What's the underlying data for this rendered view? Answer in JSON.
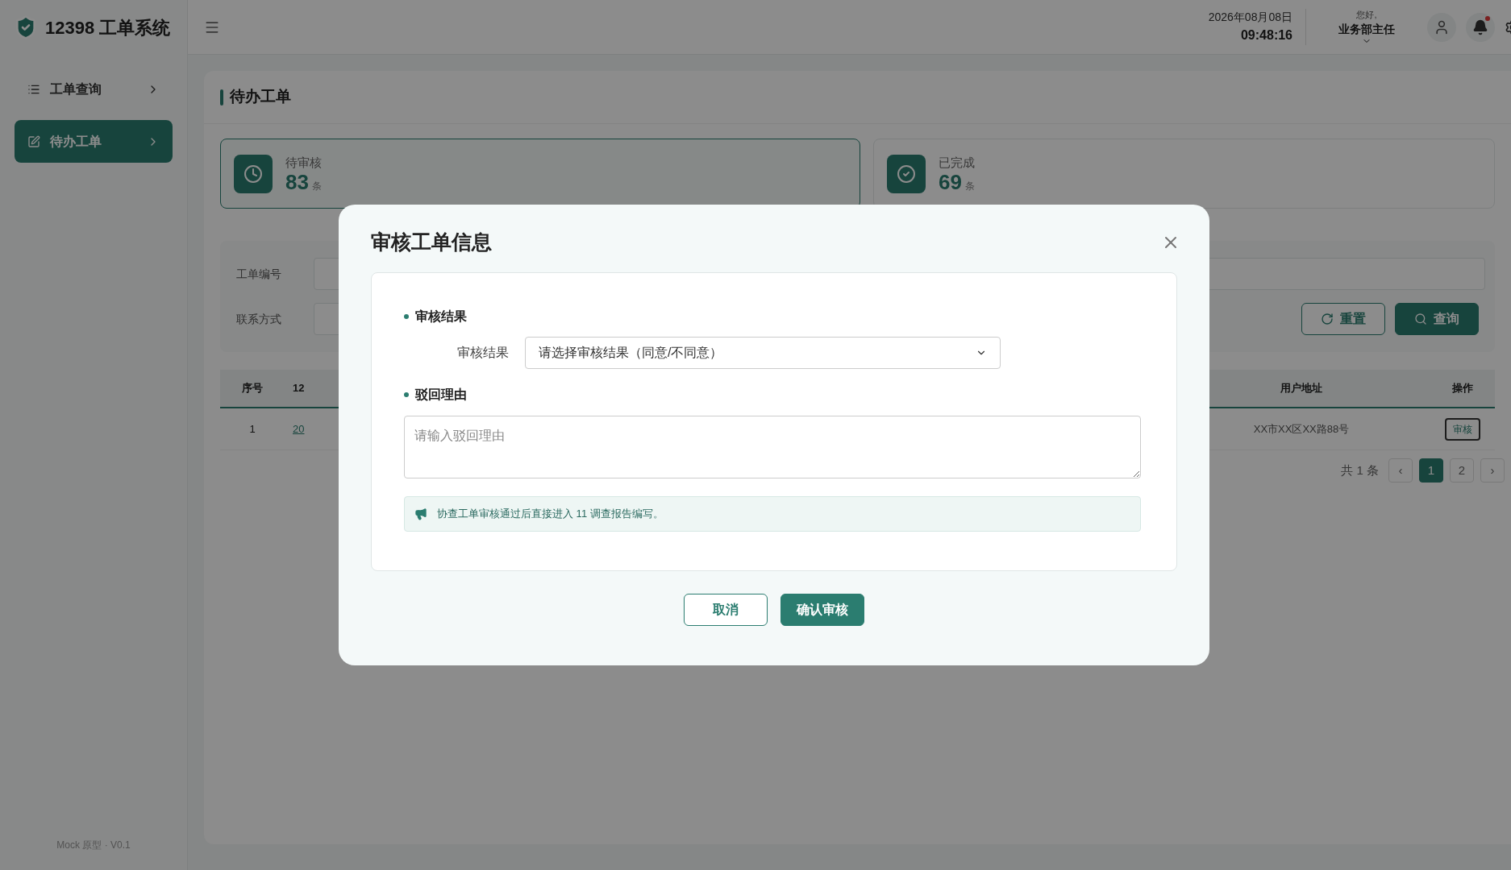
{
  "header": {
    "title": "12398 工单系统",
    "date": "2026年08月08日",
    "time": "09:48:16",
    "greeting": "您好,",
    "user": "业务部主任",
    "notification_dot": true
  },
  "sidebar": {
    "items": [
      {
        "label": "工单查询",
        "selected": false
      },
      {
        "label": "待办工单",
        "selected": true
      }
    ],
    "footer": "Mock 原型 · V0.1"
  },
  "page": {
    "title": "待办工单",
    "stats": [
      {
        "label": "待审核",
        "value": "83",
        "unit": "条",
        "kind": "pending",
        "selected": true
      },
      {
        "label": "已完成",
        "value": "69",
        "unit": "条",
        "kind": "done",
        "selected": false
      }
    ],
    "filters": [
      {
        "label": "工单编号"
      },
      {
        "label": "联系方式"
      }
    ],
    "buttons": [
      {
        "label": "重置",
        "kind": "secondary"
      },
      {
        "label": "查询",
        "kind": "primary"
      }
    ],
    "table": {
      "columns": [
        "序号",
        "12",
        "用户地址",
        "操作"
      ],
      "rows": [
        {
          "index": "1",
          "column_2": "20",
          "address": "XX市XX区XX路88号",
          "action": "审核"
        }
      ]
    },
    "pagination": {
      "total": "共 1 条",
      "prev": "‹",
      "pages": [
        {
          "label": "1",
          "selected": true
        },
        {
          "label": "2",
          "selected": false
        }
      ],
      "next": "›"
    }
  },
  "modal": {
    "title": "审核工单信息",
    "sections": [
      {
        "heading": "审核结果",
        "kind": "select",
        "label": "审核结果",
        "placeholder": "请选择审核结果（同意/不同意）"
      },
      {
        "heading": "驳回理由",
        "kind": "textarea",
        "placeholder": "请输入驳回理由"
      }
    ],
    "notice": "协查工单审核通过后直接进入 11 调查报告编写。",
    "buttons": [
      {
        "label": "取消",
        "kind": "secondary"
      },
      {
        "label": "确认审核",
        "kind": "primary"
      }
    ]
  }
}
